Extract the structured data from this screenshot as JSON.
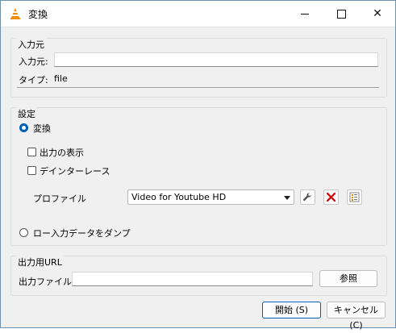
{
  "window": {
    "title": "変換",
    "icon": "vlc-cone-icon",
    "controls": {
      "minimize": "minimize-icon",
      "maximize": "maximize-icon",
      "close": "close-icon"
    }
  },
  "source": {
    "group_label": "入力元",
    "input_label": "入力元:",
    "input_value": "",
    "type_label": "タイプ:",
    "type_value": "file"
  },
  "settings": {
    "group_label": "設定",
    "convert_radio_label": "変換",
    "convert_selected": true,
    "show_output_label": "出力の表示",
    "show_output_checked": false,
    "deinterlace_label": "デインターレース",
    "deinterlace_checked": false,
    "profile_label": "プロファイル",
    "profile_selected": "Video for Youtube HD",
    "raw_dump_label": "ロー入力データをダンプ",
    "raw_dump_selected": false
  },
  "destination": {
    "group_label": "出力用URL",
    "output_file_label": "出力ファイル:",
    "output_file_value": "",
    "browse_label": "参照"
  },
  "footer": {
    "start_label": "開始 (S)",
    "cancel_label": "キャンセル (C)"
  },
  "colors": {
    "accent": "#005fb8",
    "vlc_orange": "#f08c00",
    "delete_red": "#d40000"
  }
}
